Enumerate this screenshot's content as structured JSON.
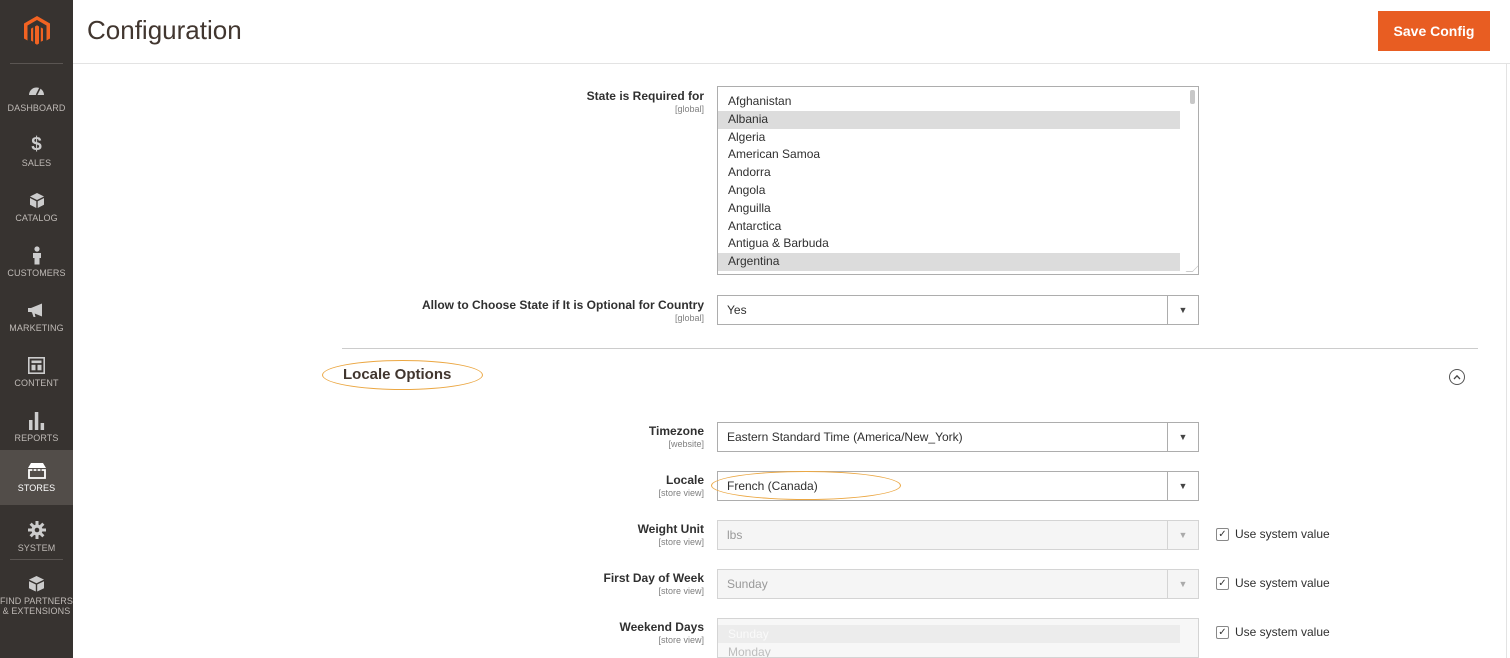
{
  "sidebar": {
    "logo": "magento-logo",
    "items": [
      {
        "label": "DASHBOARD",
        "icon": "dashboard-gauge-icon"
      },
      {
        "label": "SALES",
        "icon": "dollar-icon"
      },
      {
        "label": "CATALOG",
        "icon": "box-icon"
      },
      {
        "label": "CUSTOMERS",
        "icon": "person-icon"
      },
      {
        "label": "MARKETING",
        "icon": "megaphone-icon"
      },
      {
        "label": "CONTENT",
        "icon": "layout-icon"
      },
      {
        "label": "REPORTS",
        "icon": "bar-chart-icon"
      },
      {
        "label": "STORES",
        "icon": "storefront-icon"
      },
      {
        "label": "SYSTEM",
        "icon": "gear-icon"
      },
      {
        "label": "FIND PARTNERS",
        "label2": "& EXTENSIONS",
        "icon": "partners-box-icon"
      }
    ],
    "active": "STORES"
  },
  "header": {
    "title": "Configuration",
    "save_label": "Save Config"
  },
  "fields": {
    "state_required": {
      "label": "State is Required for",
      "scope": "[global]",
      "options": [
        "Afghanistan",
        "Albania",
        "Algeria",
        "American Samoa",
        "Andorra",
        "Angola",
        "Anguilla",
        "Antarctica",
        "Antigua & Barbuda",
        "Argentina"
      ],
      "selected": [
        "Albania",
        "Argentina"
      ]
    },
    "allow_optional": {
      "label": "Allow to Choose State if It is Optional for Country",
      "scope": "[global]",
      "value": "Yes"
    },
    "locale_section": {
      "title": "Locale Options"
    },
    "timezone": {
      "label": "Timezone",
      "scope": "[website]",
      "value": "Eastern Standard Time (America/New_York)"
    },
    "locale": {
      "label": "Locale",
      "scope": "[store view]",
      "value": "French (Canada)"
    },
    "weight_unit": {
      "label": "Weight Unit",
      "scope": "[store view]",
      "value": "lbs",
      "system_value_label": "Use system value",
      "use_system": true
    },
    "first_day": {
      "label": "First Day of Week",
      "scope": "[store view]",
      "value": "Sunday",
      "system_value_label": "Use system value",
      "use_system": true
    },
    "weekend_days": {
      "label": "Weekend Days",
      "scope": "[store view]",
      "options": [
        "Sunday",
        "Monday"
      ],
      "system_value_label": "Use system value",
      "use_system": true
    }
  },
  "colors": {
    "sidebar_bg": "#373330",
    "accent": "#e85d22",
    "highlight": "#eba743"
  }
}
